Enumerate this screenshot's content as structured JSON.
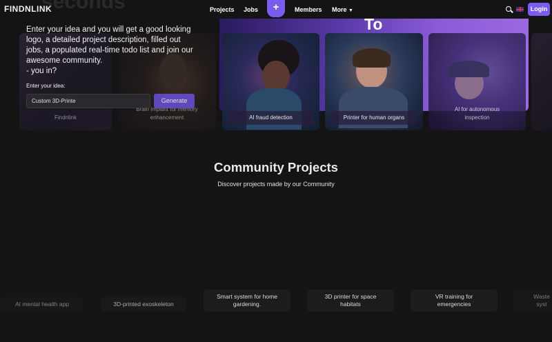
{
  "nav": {
    "logo": "FINDNLINK",
    "ghost_text": "seconds",
    "links": [
      "Projects",
      "Jobs",
      "Members",
      "More"
    ],
    "plus_label": "+",
    "login_label": "Login"
  },
  "hero": {
    "banner_word": "To",
    "description": "Enter your idea and you will get a good looking logo, a detailed project description, filled out jobs, a populated real-time todo list and join our awesome community.\n- you in?",
    "input_label": "Enter your idea:",
    "input_value": "Custom 3D-Printe",
    "generate_label": "Generate",
    "cards": [
      {
        "caption": "Findnlink"
      },
      {
        "caption": "Brain implant for memory enhancement"
      },
      {
        "caption": "AI fraud detection"
      },
      {
        "caption": "Printer for human organs"
      },
      {
        "caption": "AI for autonomous inspection"
      }
    ]
  },
  "community": {
    "title": "Community Projects",
    "subtitle": "Discover projects made by our Community",
    "projects": [
      "AI mental health app",
      "3D-printed exoskeleton",
      "Smart system for home gardening.",
      "3D printer for space habitats",
      "VR training for emergencies",
      "Waste syst"
    ]
  },
  "colors": {
    "accent": "#7b5cf0",
    "background": "#141414"
  }
}
